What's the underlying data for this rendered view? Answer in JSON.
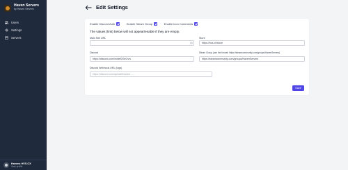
{
  "sidebar": {
    "brand_title": "Haven Servers",
    "brand_subtitle": "by Haven Servers",
    "items": [
      {
        "label": "Users",
        "icon": "users-icon"
      },
      {
        "label": "Settings",
        "icon": "gear-icon"
      },
      {
        "label": "Servers",
        "icon": "server-icon"
      }
    ],
    "user": {
      "name": "Havens HVS.CX",
      "link": "View profile"
    }
  },
  "header": {
    "title": "Edit Settings"
  },
  "form": {
    "checkboxes": [
      {
        "label": "Enable Discord Auth",
        "checked": true
      },
      {
        "label": "Enable Steam Group",
        "checked": true
      },
      {
        "label": "Enable Icon Comments",
        "checked": true
      }
    ],
    "notice": "The values (link) below will not appear/enable if they are empty.",
    "main_site_url": {
      "label": "Main Site URL",
      "value": ""
    },
    "store": {
      "label": "Store",
      "value": "https://hvs.cx/store"
    },
    "discord": {
      "label": "Discord",
      "value": "https://discord.com/invite/DSeGvrv"
    },
    "steam_group": {
      "label": "Steam Group (use the format: https://steamcommunity.com/groups/HavenServers)",
      "value": "https://steamcommunity.com/groups/HavenServers"
    },
    "webhook": {
      "label": "Discord Webhook URL (logs)",
      "placeholder": "https://discord.com/api/webhooks/......"
    },
    "save_label": "Save"
  },
  "colors": {
    "sidebar": "#1f2a3d",
    "accent": "#4f46e5",
    "background": "#f3f4f6"
  }
}
